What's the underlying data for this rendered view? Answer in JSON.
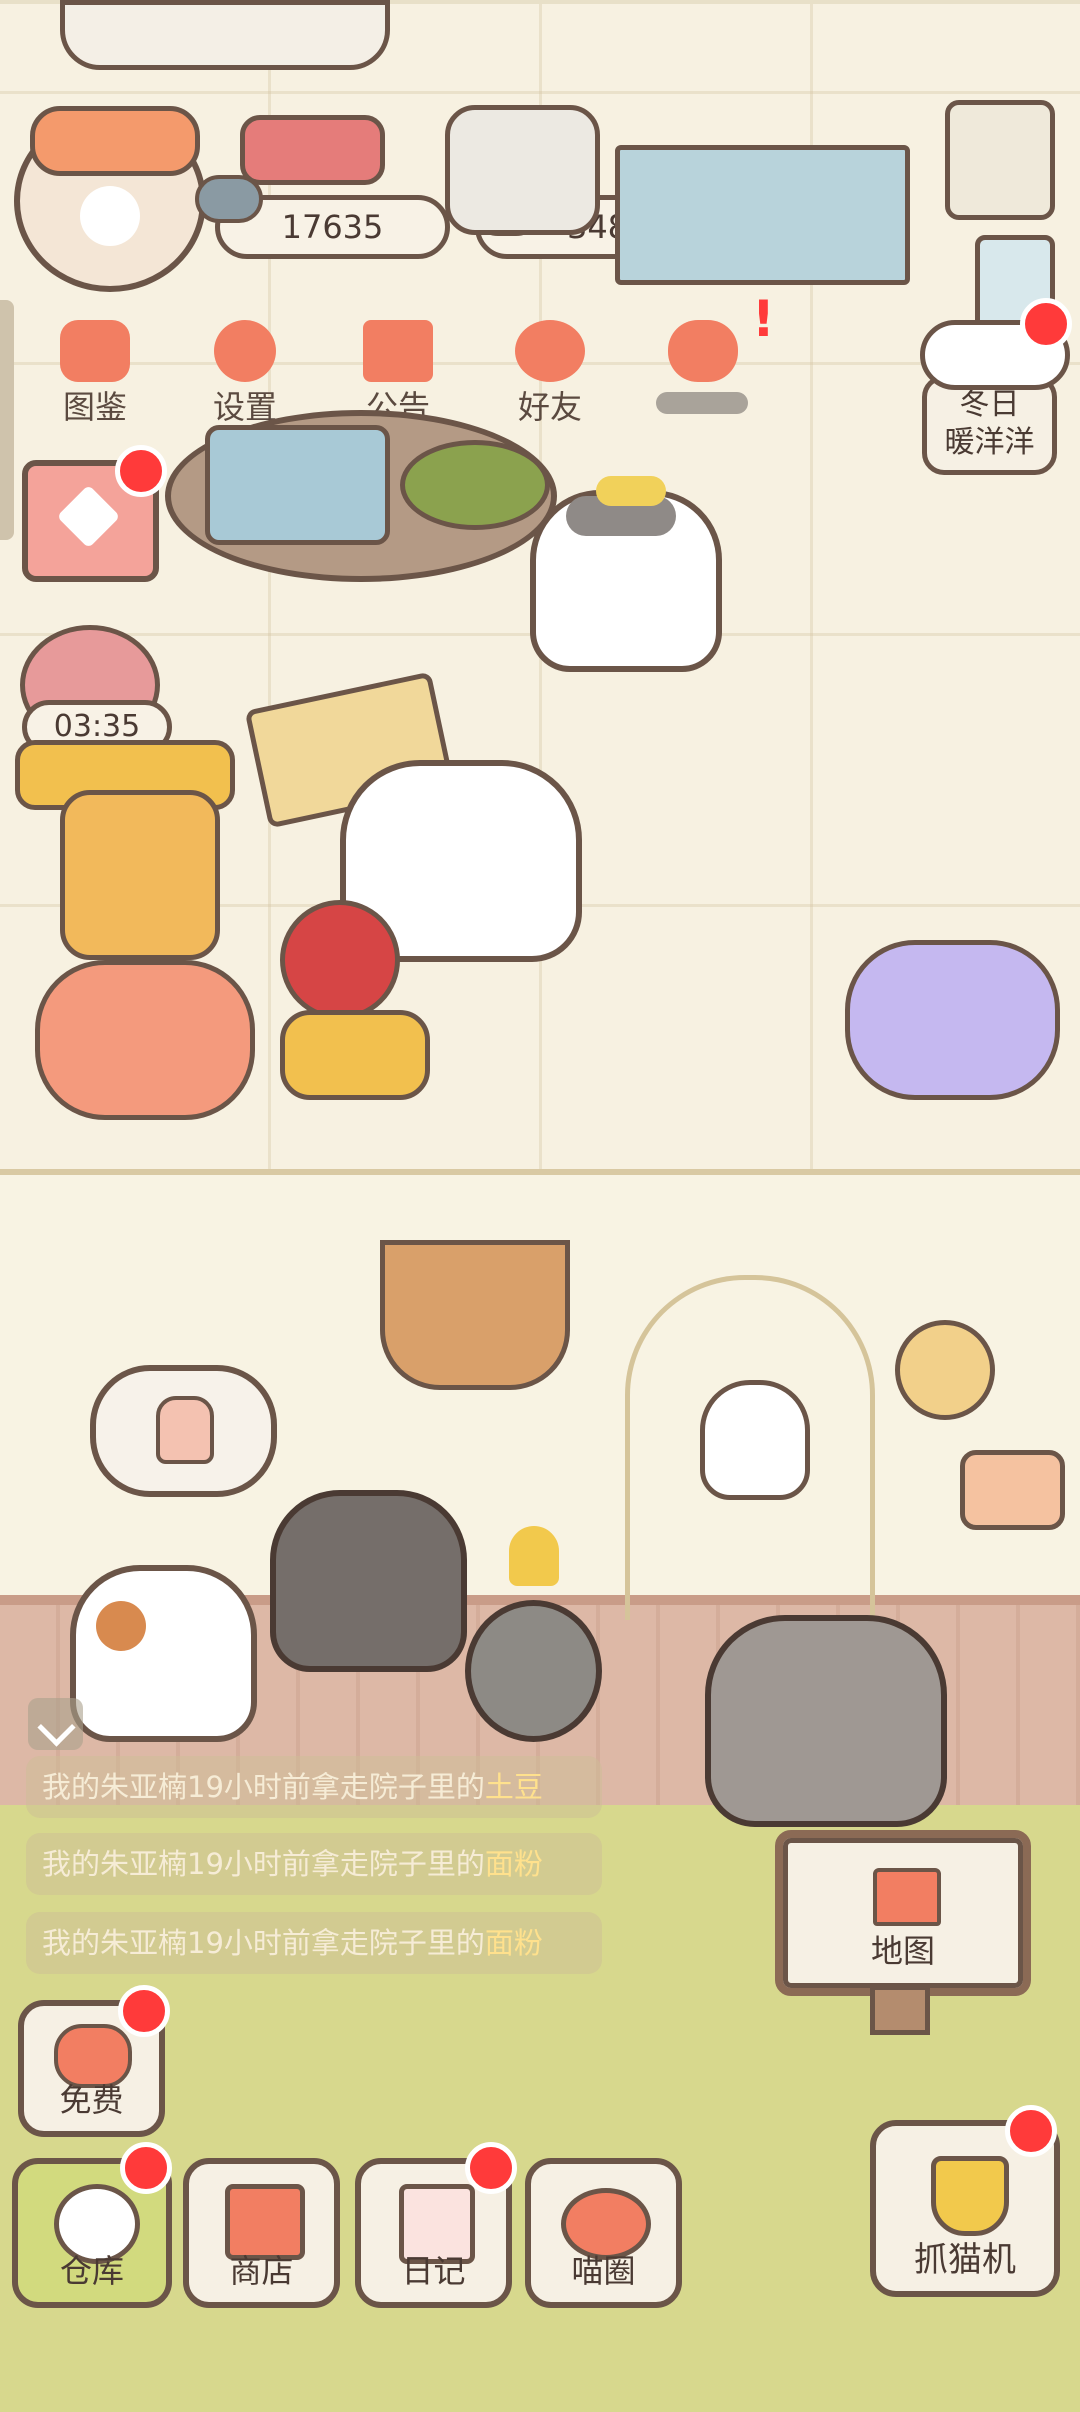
{
  "currency": {
    "fish": "17635",
    "hearts": "348"
  },
  "top_menu": [
    {
      "label": "图鉴",
      "icon": "cat-face-icon"
    },
    {
      "label": "设置",
      "icon": "gear-icon"
    },
    {
      "label": "公告",
      "icon": "gift-icon"
    },
    {
      "label": "好友",
      "icon": "friends-icon"
    },
    {
      "label": "",
      "icon": "mail-heart-icon"
    }
  ],
  "event": {
    "label_line1": "冬日",
    "label_line2": "暖洋洋"
  },
  "timer": "03:35",
  "messages": [
    {
      "prefix": "我的朱亚楠19小时前拿走院子里的",
      "item": "土豆"
    },
    {
      "prefix": "我的朱亚楠19小时前拿走院子里的",
      "item": "面粉"
    },
    {
      "prefix": "我的朱亚楠19小时前拿走院子里的",
      "item": "面粉"
    }
  ],
  "map_button": "地图",
  "free_button": "免费",
  "bottom_nav": [
    {
      "label": "仓库",
      "icon": "storage-icon",
      "active": true
    },
    {
      "label": "商店",
      "icon": "shop-icon"
    },
    {
      "label": "日记",
      "icon": "diary-icon"
    },
    {
      "label": "喵圈",
      "icon": "cat-planet-icon"
    }
  ],
  "catch_button": "抓猫机",
  "colors": {
    "badge": "#ff3a3a",
    "accent": "#f27e62",
    "grass": "#d7d88d"
  }
}
